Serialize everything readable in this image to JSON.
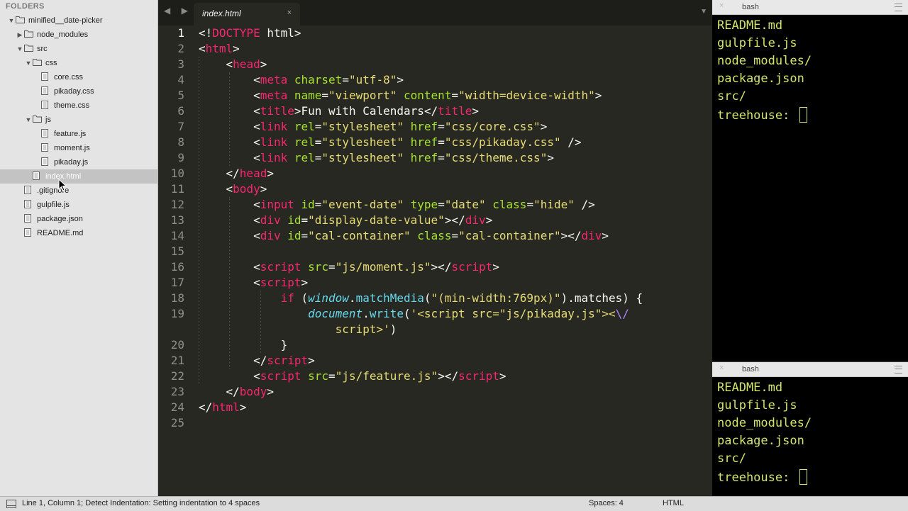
{
  "sidebar": {
    "header": "FOLDERS",
    "tree": [
      {
        "label": "minified__date-picker",
        "kind": "folder",
        "open": true,
        "depth": 0
      },
      {
        "label": "node_modules",
        "kind": "folder",
        "open": false,
        "depth": 1
      },
      {
        "label": "src",
        "kind": "folder",
        "open": true,
        "depth": 1
      },
      {
        "label": "css",
        "kind": "folder",
        "open": true,
        "depth": 2
      },
      {
        "label": "core.css",
        "kind": "file",
        "depth": 3
      },
      {
        "label": "pikaday.css",
        "kind": "file",
        "depth": 3
      },
      {
        "label": "theme.css",
        "kind": "file",
        "depth": 3
      },
      {
        "label": "js",
        "kind": "folder",
        "open": true,
        "depth": 2
      },
      {
        "label": "feature.js",
        "kind": "file",
        "depth": 3
      },
      {
        "label": "moment.js",
        "kind": "file",
        "depth": 3
      },
      {
        "label": "pikaday.js",
        "kind": "file",
        "depth": 3
      },
      {
        "label": "index.html",
        "kind": "file",
        "depth": 2,
        "selected": true
      },
      {
        "label": ".gitignore",
        "kind": "file",
        "depth": 1
      },
      {
        "label": "gulpfile.js",
        "kind": "file",
        "depth": 1
      },
      {
        "label": "package.json",
        "kind": "file",
        "depth": 1
      },
      {
        "label": "README.md",
        "kind": "file",
        "depth": 1
      }
    ]
  },
  "editor": {
    "nav_arrows": "◀ ▶",
    "tab": {
      "title": "index.html",
      "close": "×"
    },
    "tab_menu": "▼",
    "current_line": 1,
    "lines": [
      [
        {
          "t": "<!",
          "c": ""
        },
        {
          "t": "DOCTYPE",
          "c": "tg"
        },
        {
          "t": " html>",
          "c": ""
        }
      ],
      [
        {
          "t": "<",
          "c": ""
        },
        {
          "t": "html",
          "c": "tg"
        },
        {
          "t": ">",
          "c": ""
        }
      ],
      [
        {
          "t": "    <",
          "c": ""
        },
        {
          "t": "head",
          "c": "tg"
        },
        {
          "t": ">",
          "c": ""
        }
      ],
      [
        {
          "t": "        <",
          "c": ""
        },
        {
          "t": "meta",
          "c": "tg"
        },
        {
          "t": " ",
          "c": ""
        },
        {
          "t": "charset",
          "c": "at"
        },
        {
          "t": "=",
          "c": ""
        },
        {
          "t": "\"utf-8\"",
          "c": "st"
        },
        {
          "t": ">",
          "c": ""
        }
      ],
      [
        {
          "t": "        <",
          "c": ""
        },
        {
          "t": "meta",
          "c": "tg"
        },
        {
          "t": " ",
          "c": ""
        },
        {
          "t": "name",
          "c": "at"
        },
        {
          "t": "=",
          "c": ""
        },
        {
          "t": "\"viewport\"",
          "c": "st"
        },
        {
          "t": " ",
          "c": ""
        },
        {
          "t": "content",
          "c": "at"
        },
        {
          "t": "=",
          "c": ""
        },
        {
          "t": "\"width=device-width\"",
          "c": "st"
        },
        {
          "t": ">",
          "c": ""
        }
      ],
      [
        {
          "t": "        <",
          "c": ""
        },
        {
          "t": "title",
          "c": "tg"
        },
        {
          "t": ">Fun with Calendars</",
          "c": ""
        },
        {
          "t": "title",
          "c": "tg"
        },
        {
          "t": ">",
          "c": ""
        }
      ],
      [
        {
          "t": "        <",
          "c": ""
        },
        {
          "t": "link",
          "c": "tg"
        },
        {
          "t": " ",
          "c": ""
        },
        {
          "t": "rel",
          "c": "at"
        },
        {
          "t": "=",
          "c": ""
        },
        {
          "t": "\"stylesheet\"",
          "c": "st"
        },
        {
          "t": " ",
          "c": ""
        },
        {
          "t": "href",
          "c": "at"
        },
        {
          "t": "=",
          "c": ""
        },
        {
          "t": "\"css/core.css\"",
          "c": "st"
        },
        {
          "t": ">",
          "c": ""
        }
      ],
      [
        {
          "t": "        <",
          "c": ""
        },
        {
          "t": "link",
          "c": "tg"
        },
        {
          "t": " ",
          "c": ""
        },
        {
          "t": "rel",
          "c": "at"
        },
        {
          "t": "=",
          "c": ""
        },
        {
          "t": "\"stylesheet\"",
          "c": "st"
        },
        {
          "t": " ",
          "c": ""
        },
        {
          "t": "href",
          "c": "at"
        },
        {
          "t": "=",
          "c": ""
        },
        {
          "t": "\"css/pikaday.css\"",
          "c": "st"
        },
        {
          "t": " />",
          "c": ""
        }
      ],
      [
        {
          "t": "        <",
          "c": ""
        },
        {
          "t": "link",
          "c": "tg"
        },
        {
          "t": " ",
          "c": ""
        },
        {
          "t": "rel",
          "c": "at"
        },
        {
          "t": "=",
          "c": ""
        },
        {
          "t": "\"stylesheet\"",
          "c": "st"
        },
        {
          "t": " ",
          "c": ""
        },
        {
          "t": "href",
          "c": "at"
        },
        {
          "t": "=",
          "c": ""
        },
        {
          "t": "\"css/theme.css\"",
          "c": "st"
        },
        {
          "t": ">",
          "c": ""
        }
      ],
      [
        {
          "t": "    </",
          "c": ""
        },
        {
          "t": "head",
          "c": "tg"
        },
        {
          "t": ">",
          "c": ""
        }
      ],
      [
        {
          "t": "    <",
          "c": ""
        },
        {
          "t": "body",
          "c": "tg"
        },
        {
          "t": ">",
          "c": ""
        }
      ],
      [
        {
          "t": "        <",
          "c": ""
        },
        {
          "t": "input",
          "c": "tg"
        },
        {
          "t": " ",
          "c": ""
        },
        {
          "t": "id",
          "c": "at"
        },
        {
          "t": "=",
          "c": ""
        },
        {
          "t": "\"event-date\"",
          "c": "st"
        },
        {
          "t": " ",
          "c": ""
        },
        {
          "t": "type",
          "c": "at"
        },
        {
          "t": "=",
          "c": ""
        },
        {
          "t": "\"date\"",
          "c": "st"
        },
        {
          "t": " ",
          "c": ""
        },
        {
          "t": "class",
          "c": "at"
        },
        {
          "t": "=",
          "c": ""
        },
        {
          "t": "\"hide\"",
          "c": "st"
        },
        {
          "t": " />",
          "c": ""
        }
      ],
      [
        {
          "t": "        <",
          "c": ""
        },
        {
          "t": "div",
          "c": "tg"
        },
        {
          "t": " ",
          "c": ""
        },
        {
          "t": "id",
          "c": "at"
        },
        {
          "t": "=",
          "c": ""
        },
        {
          "t": "\"display-date-value\"",
          "c": "st"
        },
        {
          "t": "></",
          "c": ""
        },
        {
          "t": "div",
          "c": "tg"
        },
        {
          "t": ">",
          "c": ""
        }
      ],
      [
        {
          "t": "        <",
          "c": ""
        },
        {
          "t": "div",
          "c": "tg"
        },
        {
          "t": " ",
          "c": ""
        },
        {
          "t": "id",
          "c": "at"
        },
        {
          "t": "=",
          "c": ""
        },
        {
          "t": "\"cal-container\"",
          "c": "st"
        },
        {
          "t": " ",
          "c": ""
        },
        {
          "t": "class",
          "c": "at"
        },
        {
          "t": "=",
          "c": ""
        },
        {
          "t": "\"cal-container\"",
          "c": "st"
        },
        {
          "t": "></",
          "c": ""
        },
        {
          "t": "div",
          "c": "tg"
        },
        {
          "t": ">",
          "c": ""
        }
      ],
      [],
      [
        {
          "t": "        <",
          "c": ""
        },
        {
          "t": "script",
          "c": "tg"
        },
        {
          "t": " ",
          "c": ""
        },
        {
          "t": "src",
          "c": "at"
        },
        {
          "t": "=",
          "c": ""
        },
        {
          "t": "\"js/moment.js\"",
          "c": "st"
        },
        {
          "t": "></",
          "c": ""
        },
        {
          "t": "script",
          "c": "tg"
        },
        {
          "t": ">",
          "c": ""
        }
      ],
      [
        {
          "t": "        <",
          "c": ""
        },
        {
          "t": "script",
          "c": "tg"
        },
        {
          "t": ">",
          "c": ""
        }
      ],
      [
        {
          "t": "            ",
          "c": ""
        },
        {
          "t": "if",
          "c": "tg"
        },
        {
          "t": " (",
          "c": ""
        },
        {
          "t": "window",
          "c": "sp"
        },
        {
          "t": ".",
          "c": ""
        },
        {
          "t": "matchMedia",
          "c": "fn"
        },
        {
          "t": "(",
          "c": ""
        },
        {
          "t": "\"(min-width:769px)\"",
          "c": "st"
        },
        {
          "t": ").matches) {",
          "c": ""
        }
      ],
      [
        {
          "t": "                ",
          "c": ""
        },
        {
          "t": "document",
          "c": "sp"
        },
        {
          "t": ".",
          "c": ""
        },
        {
          "t": "write",
          "c": "fn"
        },
        {
          "t": "(",
          "c": ""
        },
        {
          "t": "'<script src=\"js/pikaday.js\"><",
          "c": "st"
        },
        {
          "t": "\\/",
          "c": "sc"
        }
      ],
      [
        {
          "t": "                    ",
          "c": ""
        },
        {
          "t": "script>'",
          "c": "st"
        },
        {
          "t": ")",
          "c": ""
        }
      ],
      [
        {
          "t": "            }",
          "c": ""
        }
      ],
      [
        {
          "t": "        </",
          "c": ""
        },
        {
          "t": "script",
          "c": "tg"
        },
        {
          "t": ">",
          "c": ""
        }
      ],
      [
        {
          "t": "        <",
          "c": ""
        },
        {
          "t": "script",
          "c": "tg"
        },
        {
          "t": " ",
          "c": ""
        },
        {
          "t": "src",
          "c": "at"
        },
        {
          "t": "=",
          "c": ""
        },
        {
          "t": "\"js/feature.js\"",
          "c": "st"
        },
        {
          "t": "></",
          "c": ""
        },
        {
          "t": "script",
          "c": "tg"
        },
        {
          "t": ">",
          "c": ""
        }
      ],
      [
        {
          "t": "    </",
          "c": ""
        },
        {
          "t": "body",
          "c": "tg"
        },
        {
          "t": ">",
          "c": ""
        }
      ],
      [
        {
          "t": "</",
          "c": ""
        },
        {
          "t": "html",
          "c": "tg"
        },
        {
          "t": ">",
          "c": ""
        }
      ],
      []
    ],
    "line_numbers": [
      "1",
      "2",
      "3",
      "4",
      "5",
      "6",
      "7",
      "8",
      "9",
      "10",
      "11",
      "12",
      "13",
      "14",
      "15",
      "16",
      "17",
      "18",
      "19",
      "",
      "20",
      "21",
      "22",
      "23",
      "24",
      "25"
    ]
  },
  "terminals": [
    {
      "title": "bash",
      "close": "×",
      "lines": [
        "README.md",
        "gulpfile.js",
        "node_modules/",
        "package.json",
        "src/"
      ],
      "prompt": "treehouse: "
    },
    {
      "title": "bash",
      "close": "×",
      "lines": [
        "README.md",
        "gulpfile.js",
        "node_modules/",
        "package.json",
        "src/"
      ],
      "prompt": "treehouse: "
    }
  ],
  "statusbar": {
    "message": "Line 1, Column 1; Detect Indentation: Setting indentation to 4 spaces",
    "spaces": "Spaces: 4",
    "syntax": "HTML"
  },
  "colors": {
    "editor_bg": "#272822",
    "tag": "#f92672",
    "attribute": "#a6e22e",
    "string": "#e6db74",
    "terminal_text": "#d4e36a"
  }
}
